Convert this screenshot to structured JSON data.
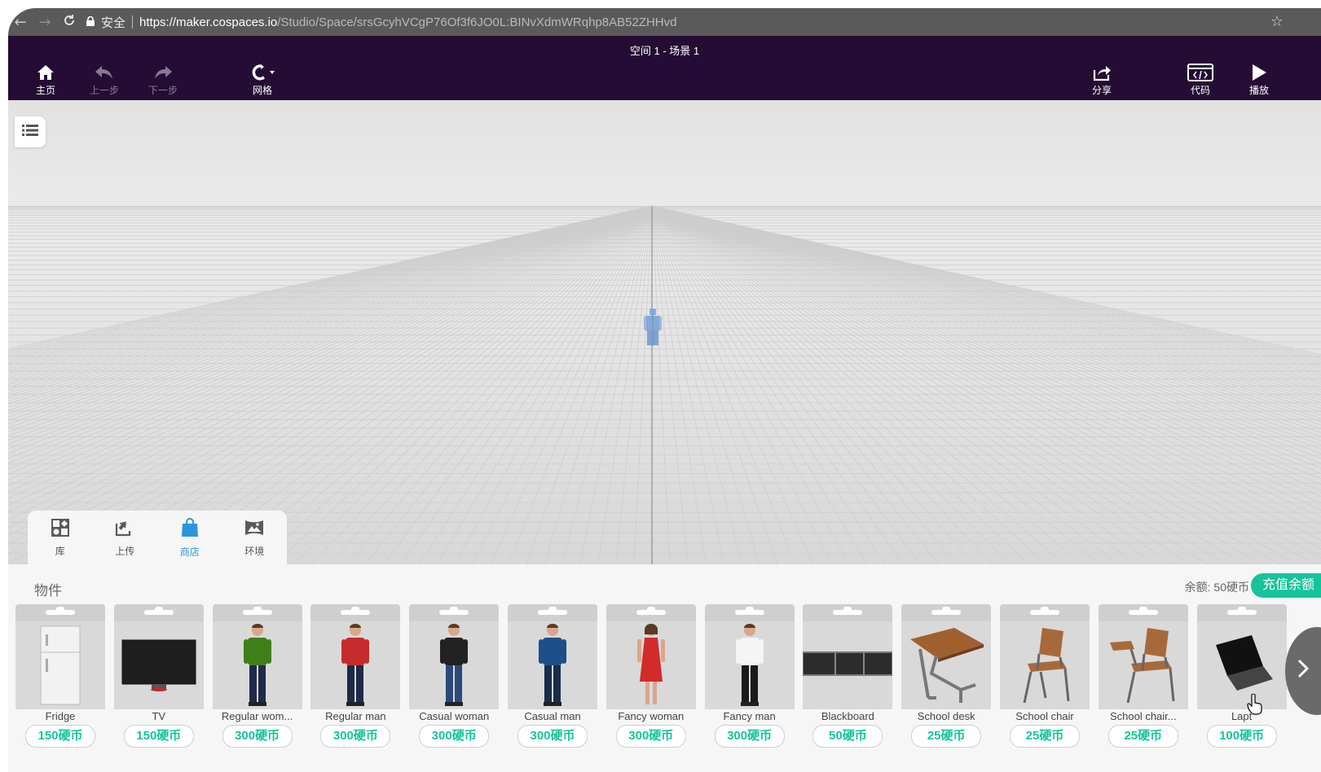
{
  "browser": {
    "back_icon": "←",
    "forward_icon": "→",
    "reload_icon": "C",
    "secure_label": "安全",
    "url_host": "https://maker.cospaces.io",
    "url_path": "/Studio/Space/srsGcyhVCgP76Of3f6JO0L:BINvXdmWRqhp8AB52ZHHvd",
    "bookmark_icon": "☆"
  },
  "header": {
    "scene_title": "空间 1 - 场景 1",
    "home": "主页",
    "undo": "上一步",
    "redo": "下一步",
    "grid": "网格",
    "share": "分享",
    "code": "代码",
    "play": "播放"
  },
  "tabs": [
    {
      "label": "库",
      "icon": "library-icon"
    },
    {
      "label": "上传",
      "icon": "upload-icon"
    },
    {
      "label": "商店",
      "icon": "shop-bag-icon",
      "active": true
    },
    {
      "label": "环境",
      "icon": "environment-icon"
    }
  ],
  "panel": {
    "category": "物件",
    "balance": "余额: 50硬币",
    "topup": "充值余额"
  },
  "items": [
    {
      "name": "Fridge",
      "price": "150硬币"
    },
    {
      "name": "TV",
      "price": "150硬币"
    },
    {
      "name": "Regular wom...",
      "price": "300硬币"
    },
    {
      "name": "Regular man",
      "price": "300硬币"
    },
    {
      "name": "Casual woman",
      "price": "300硬币"
    },
    {
      "name": "Casual man",
      "price": "300硬币"
    },
    {
      "name": "Fancy woman",
      "price": "300硬币"
    },
    {
      "name": "Fancy man",
      "price": "300硬币"
    },
    {
      "name": "Blackboard",
      "price": "50硬币"
    },
    {
      "name": "School desk",
      "price": "25硬币"
    },
    {
      "name": "School chair",
      "price": "25硬币"
    },
    {
      "name": "School chair...",
      "price": "25硬币"
    },
    {
      "name": "Lapt",
      "price": "100硬币"
    }
  ],
  "colors": {
    "header_bg": "#240c34",
    "accent_green": "#16c39a",
    "active_tab": "#2a96e0"
  }
}
